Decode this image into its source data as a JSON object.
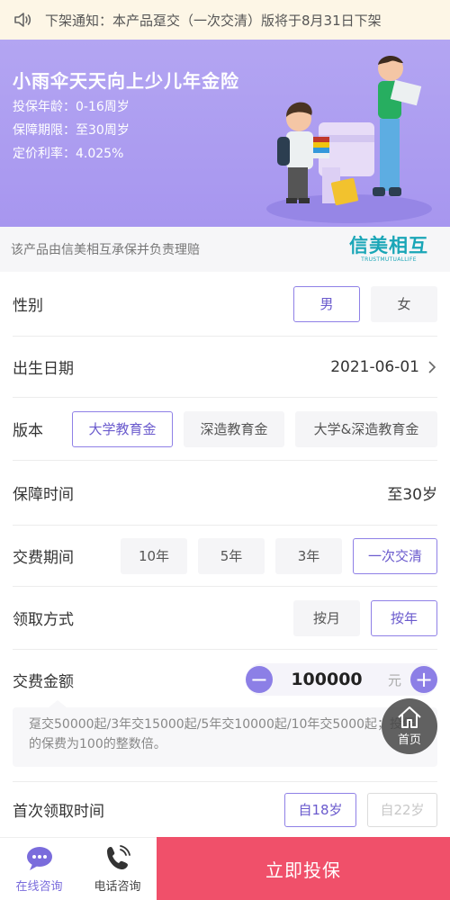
{
  "notice": {
    "text": "下架通知：本产品趸交（一次交清）版将于8月31日下架",
    "icon": "speaker-icon"
  },
  "hero": {
    "title": "小雨伞天天向上少儿年金险",
    "age_range": "投保年龄：0-16周岁",
    "coverage_term": "保障期限：至30周岁",
    "pricing_rate": "定价利率：4.025%"
  },
  "insurer": {
    "description": "该产品由信美相互承保并负责理赔",
    "logo_cn": "信美相互",
    "logo_en": "TRUSTMUTUALLIFE"
  },
  "form": {
    "gender": {
      "label": "性别",
      "options": [
        "男",
        "女"
      ],
      "selected": "男"
    },
    "birth_date": {
      "label": "出生日期",
      "value": "2021-06-01"
    },
    "edition": {
      "label": "版本",
      "options": [
        "大学教育金",
        "深造教育金",
        "大学&深造教育金"
      ],
      "selected": "大学教育金"
    },
    "coverage": {
      "label": "保障时间",
      "value": "至30岁"
    },
    "payment_period": {
      "label": "交费期间",
      "options": [
        "10年",
        "5年",
        "3年",
        "一次交清"
      ],
      "selected": "一次交清"
    },
    "claim_method": {
      "label": "领取方式",
      "options": [
        "按月",
        "按年"
      ],
      "selected": "按年"
    },
    "premium": {
      "label": "交费金额",
      "minus": "−",
      "amount": "100000",
      "unit": "元",
      "plus": "+",
      "hint": "趸交50000起/3年交15000起/5年交10000起/10年交5000起；投保的保费为100的整数倍。"
    },
    "first_claim": {
      "label": "首次领取时间",
      "options": [
        "自18岁",
        "自22岁"
      ],
      "selected": "自18岁",
      "disabled": "自22岁"
    }
  },
  "floating_home": {
    "label": "首页",
    "icon": "home-icon"
  },
  "tabbar": {
    "online": "在线咨询",
    "phone": "电话咨询",
    "buy": "立即投保"
  },
  "colors": {
    "accent": "#8c7fe6",
    "buy": "#f0506a",
    "hero": "#a796ef",
    "logo": "#1aa6b7"
  }
}
